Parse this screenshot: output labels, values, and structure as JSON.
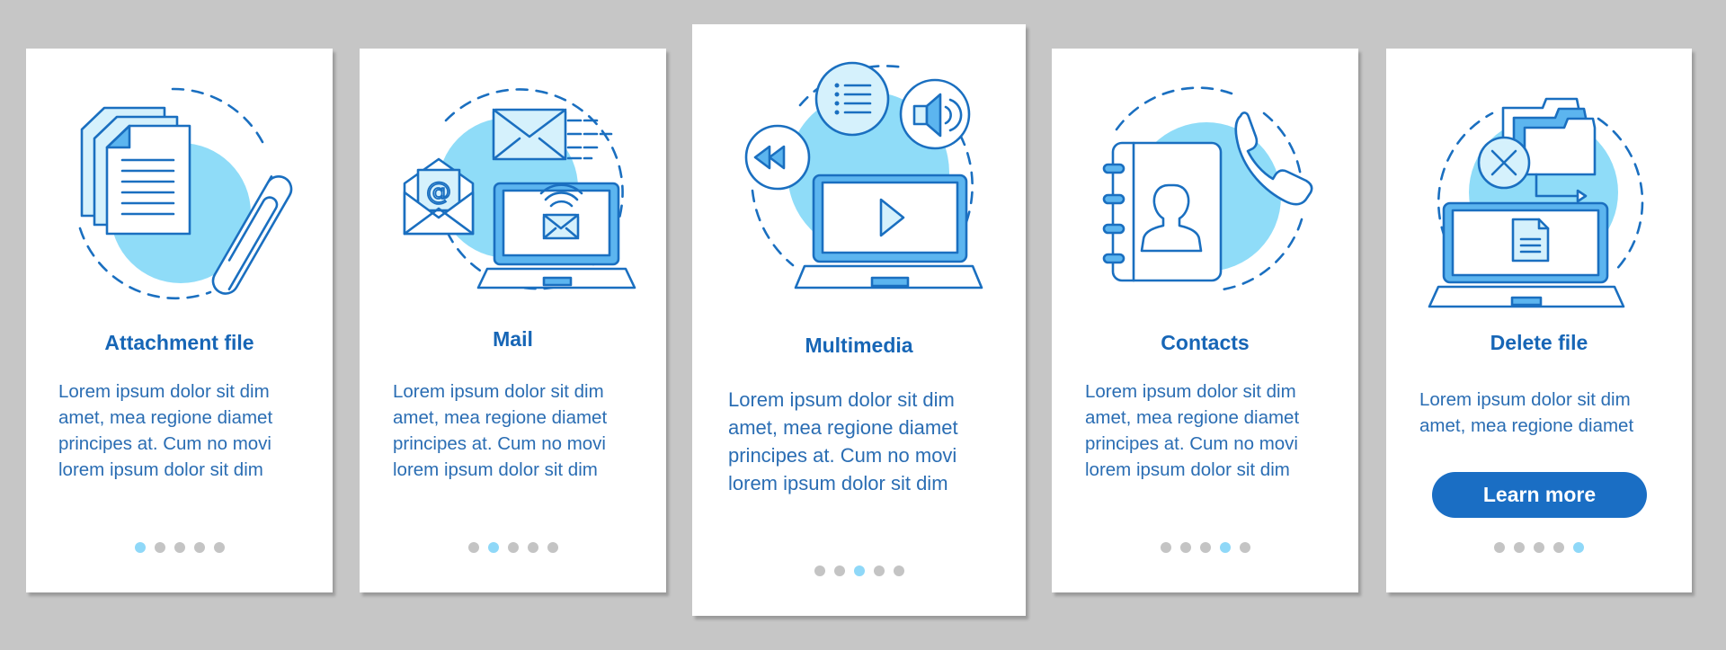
{
  "colors": {
    "background": "#c6c6c6",
    "card": "#ffffff",
    "title": "#1766b6",
    "body_text": "#2a6db3",
    "accent_circle": "#8fdcf8",
    "stroke": "#1a6fc0",
    "dot_inactive": "#c4c4c4",
    "dot_active": "#8fd8f8",
    "button": "#1a6ec4"
  },
  "cards": [
    {
      "title": "Attachment file",
      "icon": "attachment-file-icon",
      "body": "Lorem ipsum dolor sit dim\namet, mea regione diamet\nprincipes at. Cum no movi\nlorem ipsum dolor sit dim",
      "page_index": 1,
      "page_count": 5
    },
    {
      "title": "Mail",
      "icon": "mail-icon",
      "body": "Lorem ipsum dolor sit dim\namet, mea regione diamet\nprincipes at. Cum no movi\nlorem ipsum dolor sit dim",
      "page_index": 2,
      "page_count": 5
    },
    {
      "title": "Multimedia",
      "icon": "multimedia-icon",
      "body": "Lorem ipsum dolor sit dim\namet, mea regione diamet\nprincipes at. Cum no movi\nlorem ipsum dolor sit dim",
      "page_index": 3,
      "page_count": 5
    },
    {
      "title": "Contacts",
      "icon": "contacts-icon",
      "body": "Lorem ipsum dolor sit dim\namet, mea regione diamet\nprincipes at. Cum no movi\nlorem ipsum dolor sit dim",
      "page_index": 4,
      "page_count": 5
    },
    {
      "title": "Delete file",
      "icon": "delete-file-icon",
      "body": "Lorem ipsum dolor sit dim\namet, mea regione diamet",
      "page_index": 5,
      "page_count": 5,
      "button_label": "Learn more"
    }
  ]
}
